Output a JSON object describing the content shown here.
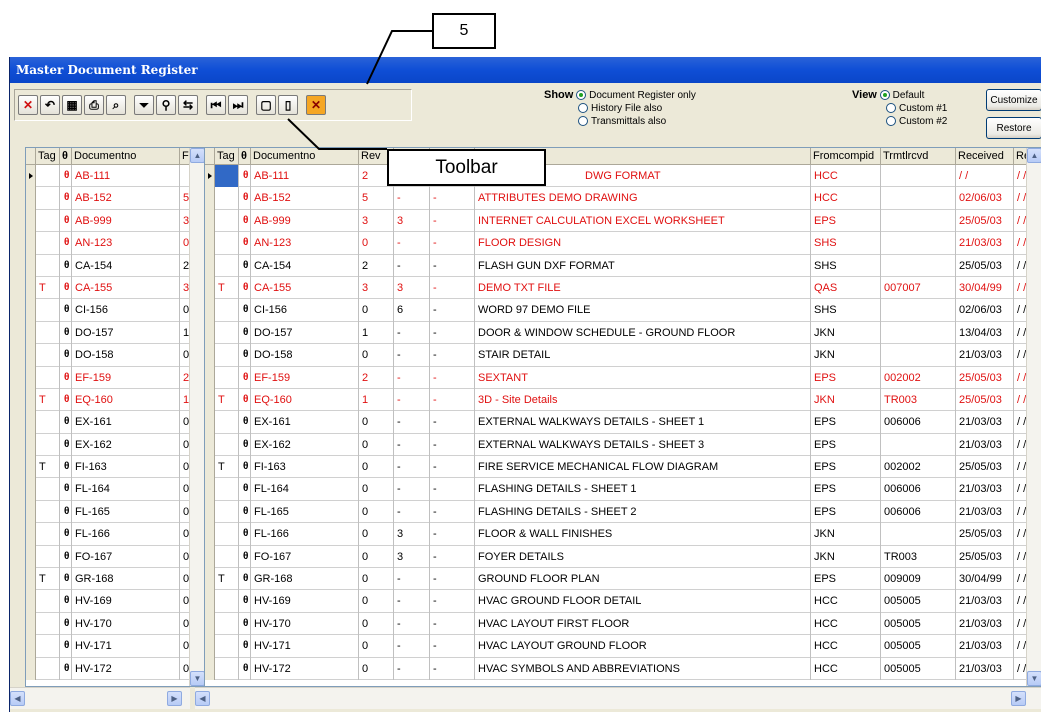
{
  "callouts": {
    "number": "5",
    "toolbar": "Toolbar"
  },
  "window": {
    "title": "Master Document Register"
  },
  "toolbar": {
    "buttons": [
      {
        "icon": "delete-icon",
        "glyph": "✕"
      },
      {
        "icon": "undo-icon",
        "glyph": "↶"
      },
      {
        "icon": "copy-icon",
        "glyph": "▦"
      },
      {
        "icon": "print-icon",
        "glyph": "⎙"
      },
      {
        "icon": "preview-icon",
        "glyph": "⌕"
      },
      {
        "icon": "filter-icon",
        "glyph": "⏷"
      },
      {
        "icon": "find-icon",
        "glyph": "⚲"
      },
      {
        "icon": "search-replace-icon",
        "glyph": "⇆"
      },
      {
        "icon": "first-record-icon",
        "glyph": "⏮"
      },
      {
        "icon": "last-record-icon",
        "glyph": "⏭"
      },
      {
        "icon": "page-icon",
        "glyph": "▢"
      },
      {
        "icon": "new-page-icon",
        "glyph": "▯"
      },
      {
        "icon": "close-icon",
        "glyph": "✕"
      }
    ]
  },
  "show": {
    "label": "Show",
    "options": [
      "Document Register only",
      "History File also",
      "Transmittals also"
    ],
    "selected": 0
  },
  "view": {
    "label": "View",
    "options": [
      "Default",
      "Custom #1",
      "Custom #2"
    ],
    "selected": 0
  },
  "buttons": {
    "customize": "Customize",
    "restore": "Restore"
  },
  "left_grid": {
    "headers": [
      "Tag",
      "θ",
      "Documentno",
      "F"
    ]
  },
  "right_grid": {
    "headers": [
      "Tag",
      "θ",
      "Documentno",
      "Rev",
      "",
      "",
      "",
      "Fromcompid",
      "Trmtlrcvd",
      "Received",
      "Re"
    ]
  },
  "rows": [
    {
      "tag": "",
      "doc": "AB-111",
      "left_f": "",
      "rev": "2",
      "c5": "",
      "c6": "",
      "title": "DWG FORMAT",
      "from": "HCC",
      "trm": "",
      "rec": "/ /",
      "re": "/ /",
      "red": true,
      "current": true
    },
    {
      "tag": "",
      "doc": "AB-152",
      "left_f": "5",
      "rev": "5",
      "c5": "-",
      "c6": "-",
      "title": "ATTRIBUTES DEMO DRAWING",
      "from": "HCC",
      "trm": "",
      "rec": "02/06/03",
      "re": "/ /",
      "red": true
    },
    {
      "tag": "",
      "doc": "AB-999",
      "left_f": "3",
      "rev": "3",
      "c5": "3",
      "c6": "-",
      "title": "INTERNET CALCULATION EXCEL WORKSHEET",
      "from": "EPS",
      "trm": "",
      "rec": "25/05/03",
      "re": "/ /",
      "red": true
    },
    {
      "tag": "",
      "doc": "AN-123",
      "left_f": "0",
      "rev": "0",
      "c5": "-",
      "c6": "-",
      "title": "FLOOR DESIGN",
      "from": "SHS",
      "trm": "",
      "rec": "21/03/03",
      "re": "/ /",
      "red": true
    },
    {
      "tag": "",
      "doc": "CA-154",
      "left_f": "2",
      "rev": "2",
      "c5": "-",
      "c6": "-",
      "title": "FLASH GUN DXF FORMAT",
      "from": "SHS",
      "trm": "",
      "rec": "25/05/03",
      "re": "/ /",
      "red": false
    },
    {
      "tag": "T",
      "doc": "CA-155",
      "left_f": "3",
      "rev": "3",
      "c5": "3",
      "c6": "-",
      "title": "DEMO TXT FILE",
      "from": "QAS",
      "trm": "007007",
      "rec": "30/04/99",
      "re": "/ /",
      "red": true
    },
    {
      "tag": "",
      "doc": "CI-156",
      "left_f": "0",
      "rev": "0",
      "c5": "6",
      "c6": "-",
      "title": "WORD 97 DEMO FILE",
      "from": "SHS",
      "trm": "",
      "rec": "02/06/03",
      "re": "/ /",
      "red": false
    },
    {
      "tag": "",
      "doc": "DO-157",
      "left_f": "1",
      "rev": "1",
      "c5": "-",
      "c6": "-",
      "title": "DOOR & WINDOW SCHEDULE - GROUND FLOOR",
      "from": "JKN",
      "trm": "",
      "rec": "13/04/03",
      "re": "/ /",
      "red": false
    },
    {
      "tag": "",
      "doc": "DO-158",
      "left_f": "0",
      "rev": "0",
      "c5": "-",
      "c6": "-",
      "title": "STAIR DETAIL",
      "from": "JKN",
      "trm": "",
      "rec": "21/03/03",
      "re": "/ /",
      "red": false
    },
    {
      "tag": "",
      "doc": "EF-159",
      "left_f": "2",
      "rev": "2",
      "c5": "-",
      "c6": "-",
      "title": "SEXTANT",
      "from": "EPS",
      "trm": "002002",
      "rec": "25/05/03",
      "re": "/ /",
      "red": true
    },
    {
      "tag": "T",
      "doc": "EQ-160",
      "left_f": "1",
      "rev": "1",
      "c5": "-",
      "c6": "-",
      "title": "3D - Site Details",
      "from": "JKN",
      "trm": "TR003",
      "rec": "25/05/03",
      "re": "/ /",
      "red": true
    },
    {
      "tag": "",
      "doc": "EX-161",
      "left_f": "0",
      "rev": "0",
      "c5": "-",
      "c6": "-",
      "title": "EXTERNAL WALKWAYS DETAILS - SHEET 1",
      "from": "EPS",
      "trm": "006006",
      "rec": "21/03/03",
      "re": "/ /",
      "red": false
    },
    {
      "tag": "",
      "doc": "EX-162",
      "left_f": "0",
      "rev": "0",
      "c5": "-",
      "c6": "-",
      "title": "EXTERNAL WALKWAYS DETAILS - SHEET 3",
      "from": "EPS",
      "trm": "",
      "rec": "21/03/03",
      "re": "/ /",
      "red": false
    },
    {
      "tag": "T",
      "doc": "FI-163",
      "left_f": "0",
      "rev": "0",
      "c5": "-",
      "c6": "-",
      "title": "FIRE SERVICE MECHANICAL FLOW DIAGRAM",
      "from": "EPS",
      "trm": "002002",
      "rec": "25/05/03",
      "re": "/ /",
      "red": false
    },
    {
      "tag": "",
      "doc": "FL-164",
      "left_f": "0",
      "rev": "0",
      "c5": "-",
      "c6": "-",
      "title": "FLASHING DETAILS - SHEET 1",
      "from": "EPS",
      "trm": "006006",
      "rec": "21/03/03",
      "re": "/ /",
      "red": false
    },
    {
      "tag": "",
      "doc": "FL-165",
      "left_f": "0",
      "rev": "0",
      "c5": "-",
      "c6": "-",
      "title": "FLASHING DETAILS - SHEET 2",
      "from": "EPS",
      "trm": "006006",
      "rec": "21/03/03",
      "re": "/ /",
      "red": false
    },
    {
      "tag": "",
      "doc": "FL-166",
      "left_f": "0",
      "rev": "0",
      "c5": "3",
      "c6": "-",
      "title": "FLOOR & WALL FINISHES",
      "from": "JKN",
      "trm": "",
      "rec": "25/05/03",
      "re": "/ /",
      "red": false
    },
    {
      "tag": "",
      "doc": "FO-167",
      "left_f": "0",
      "rev": "0",
      "c5": "3",
      "c6": "-",
      "title": "FOYER DETAILS",
      "from": "JKN",
      "trm": "TR003",
      "rec": "25/05/03",
      "re": "/ /",
      "red": false
    },
    {
      "tag": "T",
      "doc": "GR-168",
      "left_f": "0",
      "rev": "0",
      "c5": "-",
      "c6": "-",
      "title": "GROUND FLOOR PLAN",
      "from": "EPS",
      "trm": "009009",
      "rec": "30/04/99",
      "re": "/ /",
      "red": false
    },
    {
      "tag": "",
      "doc": "HV-169",
      "left_f": "0",
      "rev": "0",
      "c5": "-",
      "c6": "-",
      "title": "HVAC GROUND FLOOR DETAIL",
      "from": "HCC",
      "trm": "005005",
      "rec": "21/03/03",
      "re": "/ /",
      "red": false
    },
    {
      "tag": "",
      "doc": "HV-170",
      "left_f": "0",
      "rev": "0",
      "c5": "-",
      "c6": "-",
      "title": "HVAC LAYOUT FIRST FLOOR",
      "from": "HCC",
      "trm": "005005",
      "rec": "21/03/03",
      "re": "/ /",
      "red": false
    },
    {
      "tag": "",
      "doc": "HV-171",
      "left_f": "0",
      "rev": "0",
      "c5": "-",
      "c6": "-",
      "title": "HVAC LAYOUT GROUND FLOOR",
      "from": "HCC",
      "trm": "005005",
      "rec": "21/03/03",
      "re": "/ /",
      "red": false
    },
    {
      "tag": "",
      "doc": "HV-172",
      "left_f": "0",
      "rev": "0",
      "c5": "-",
      "c6": "-",
      "title": "HVAC SYMBOLS AND ABBREVIATIONS",
      "from": "HCC",
      "trm": "005005",
      "rec": "21/03/03",
      "re": "/ /",
      "red": false
    }
  ],
  "colors": {
    "red_row": "#e01010",
    "title_bar": "#0f4ed6",
    "selection": "#3169c6",
    "chrome": "#ece9d8"
  }
}
